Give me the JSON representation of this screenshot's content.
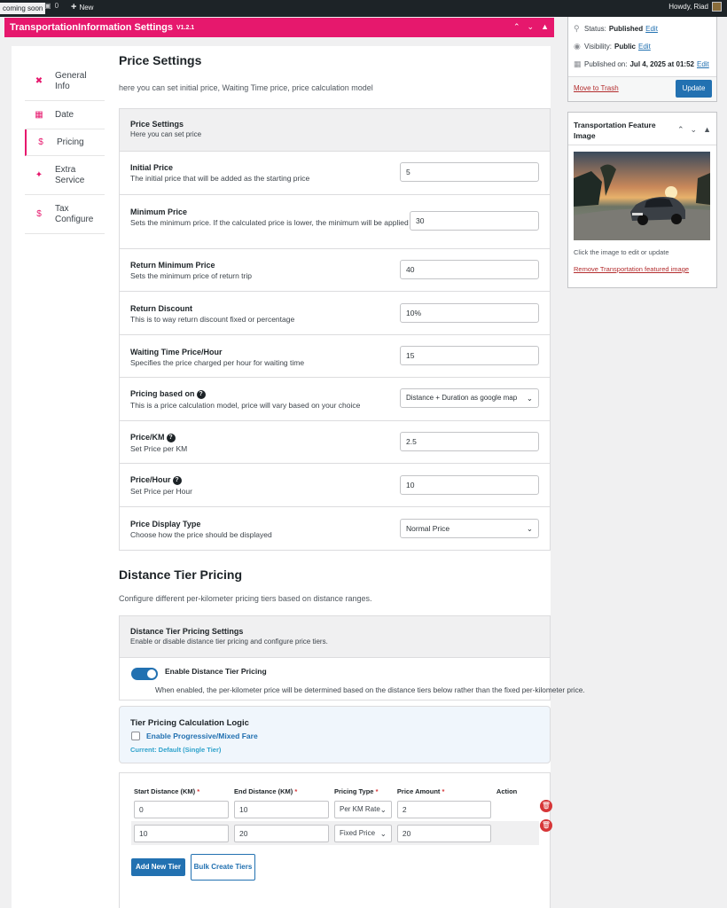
{
  "adminbar": {
    "coming_soon": "coming soon",
    "comments_count": "0",
    "new_label": "New",
    "howdy": "Howdy, Riad"
  },
  "plugin": {
    "title": "TransportationInformation Settings",
    "version": "V1.2.1"
  },
  "tabs": [
    {
      "icon": "tools-icon",
      "label_line1": "General",
      "label_line2": "Info"
    },
    {
      "icon": "calendar-icon",
      "label_line1": "Date",
      "label_line2": ""
    },
    {
      "icon": "pricing-icon",
      "label_line1": "Pricing",
      "label_line2": ""
    },
    {
      "icon": "puzzle-icon",
      "label_line1": "Extra",
      "label_line2": "Service"
    },
    {
      "icon": "tax-icon",
      "label_line1": "Tax",
      "label_line2": "Configure"
    }
  ],
  "price_settings": {
    "title": "Price Settings",
    "subtitle": "here you can set initial price, Waiting Time price, price calculation model",
    "section_title": "Price Settings",
    "section_desc": "Here you can set price",
    "rows": [
      {
        "label": "Initial Price",
        "desc": "The initial price that will be added as the starting price",
        "value": "5"
      },
      {
        "label": "Minimum Price",
        "desc": "Sets the minimum price. If the calculated price is lower, the minimum will be applied",
        "value": "30"
      },
      {
        "label": "Return Minimum Price",
        "desc": "Sets the minimum price of return trip",
        "value": "40"
      },
      {
        "label": "Return Discount",
        "desc": "This is to way return discount fixed or percentage",
        "value": "10%"
      },
      {
        "label": "Waiting Time Price/Hour",
        "desc": "Specifies the price charged per hour for waiting time",
        "value": "15"
      },
      {
        "label": "Pricing based on",
        "desc": "This is a price calculation model, price will vary based on your choice",
        "value": "Distance + Duration as google map"
      },
      {
        "label": "Price/KM",
        "desc": "Set Price per KM",
        "value": "2.5"
      },
      {
        "label": "Price/Hour",
        "desc": "Set Price per Hour",
        "value": "10"
      },
      {
        "label": "Price Display Type",
        "desc": "Choose how the price should be displayed",
        "value": "Normal Price"
      }
    ]
  },
  "tier_pricing": {
    "title": "Distance Tier Pricing",
    "subtitle": "Configure different per-kilometer pricing tiers based on distance ranges.",
    "section_title": "Distance Tier Pricing Settings",
    "section_desc": "Enable or disable distance tier pricing and configure price tiers.",
    "toggle_label": "Enable Distance Tier Pricing",
    "toggle_on": true,
    "toggle_help": "When enabled, the per-kilometer price will be determined based on the distance tiers below rather than the fixed per-kilometer price.",
    "logic_title": "Tier Pricing Calculation Logic",
    "logic_checkbox": "Enable Progressive/Mixed Fare",
    "logic_current": "Current: Default (Single Tier)",
    "columns": [
      "Start Distance (KM)",
      "End Distance (KM)",
      "Pricing Type",
      "Price Amount",
      "Action"
    ],
    "rows": [
      {
        "start": "0",
        "end": "10",
        "type": "Per KM Rate",
        "amount": "2"
      },
      {
        "start": "10",
        "end": "20",
        "type": "Fixed Price",
        "amount": "20"
      }
    ],
    "add_button": "Add New Tier",
    "bulk_button": "Bulk Create Tiers"
  },
  "publish": {
    "status_label": "Status:",
    "status_value": "Published",
    "visibility_label": "Visibility:",
    "visibility_value": "Public",
    "published_label": "Published on:",
    "published_value": "Jul 4, 2025 at 01:52",
    "edit": "Edit",
    "trash": "Move to Trash",
    "update": "Update"
  },
  "feature_image": {
    "title_line1": "Transportation Feature",
    "title_line2": "Image",
    "hint": "Click the image to edit or update",
    "remove": "Remove Transportation featured image"
  },
  "colors": {
    "accent": "#e6186d",
    "primary": "#2271b1",
    "danger": "#d63638"
  }
}
